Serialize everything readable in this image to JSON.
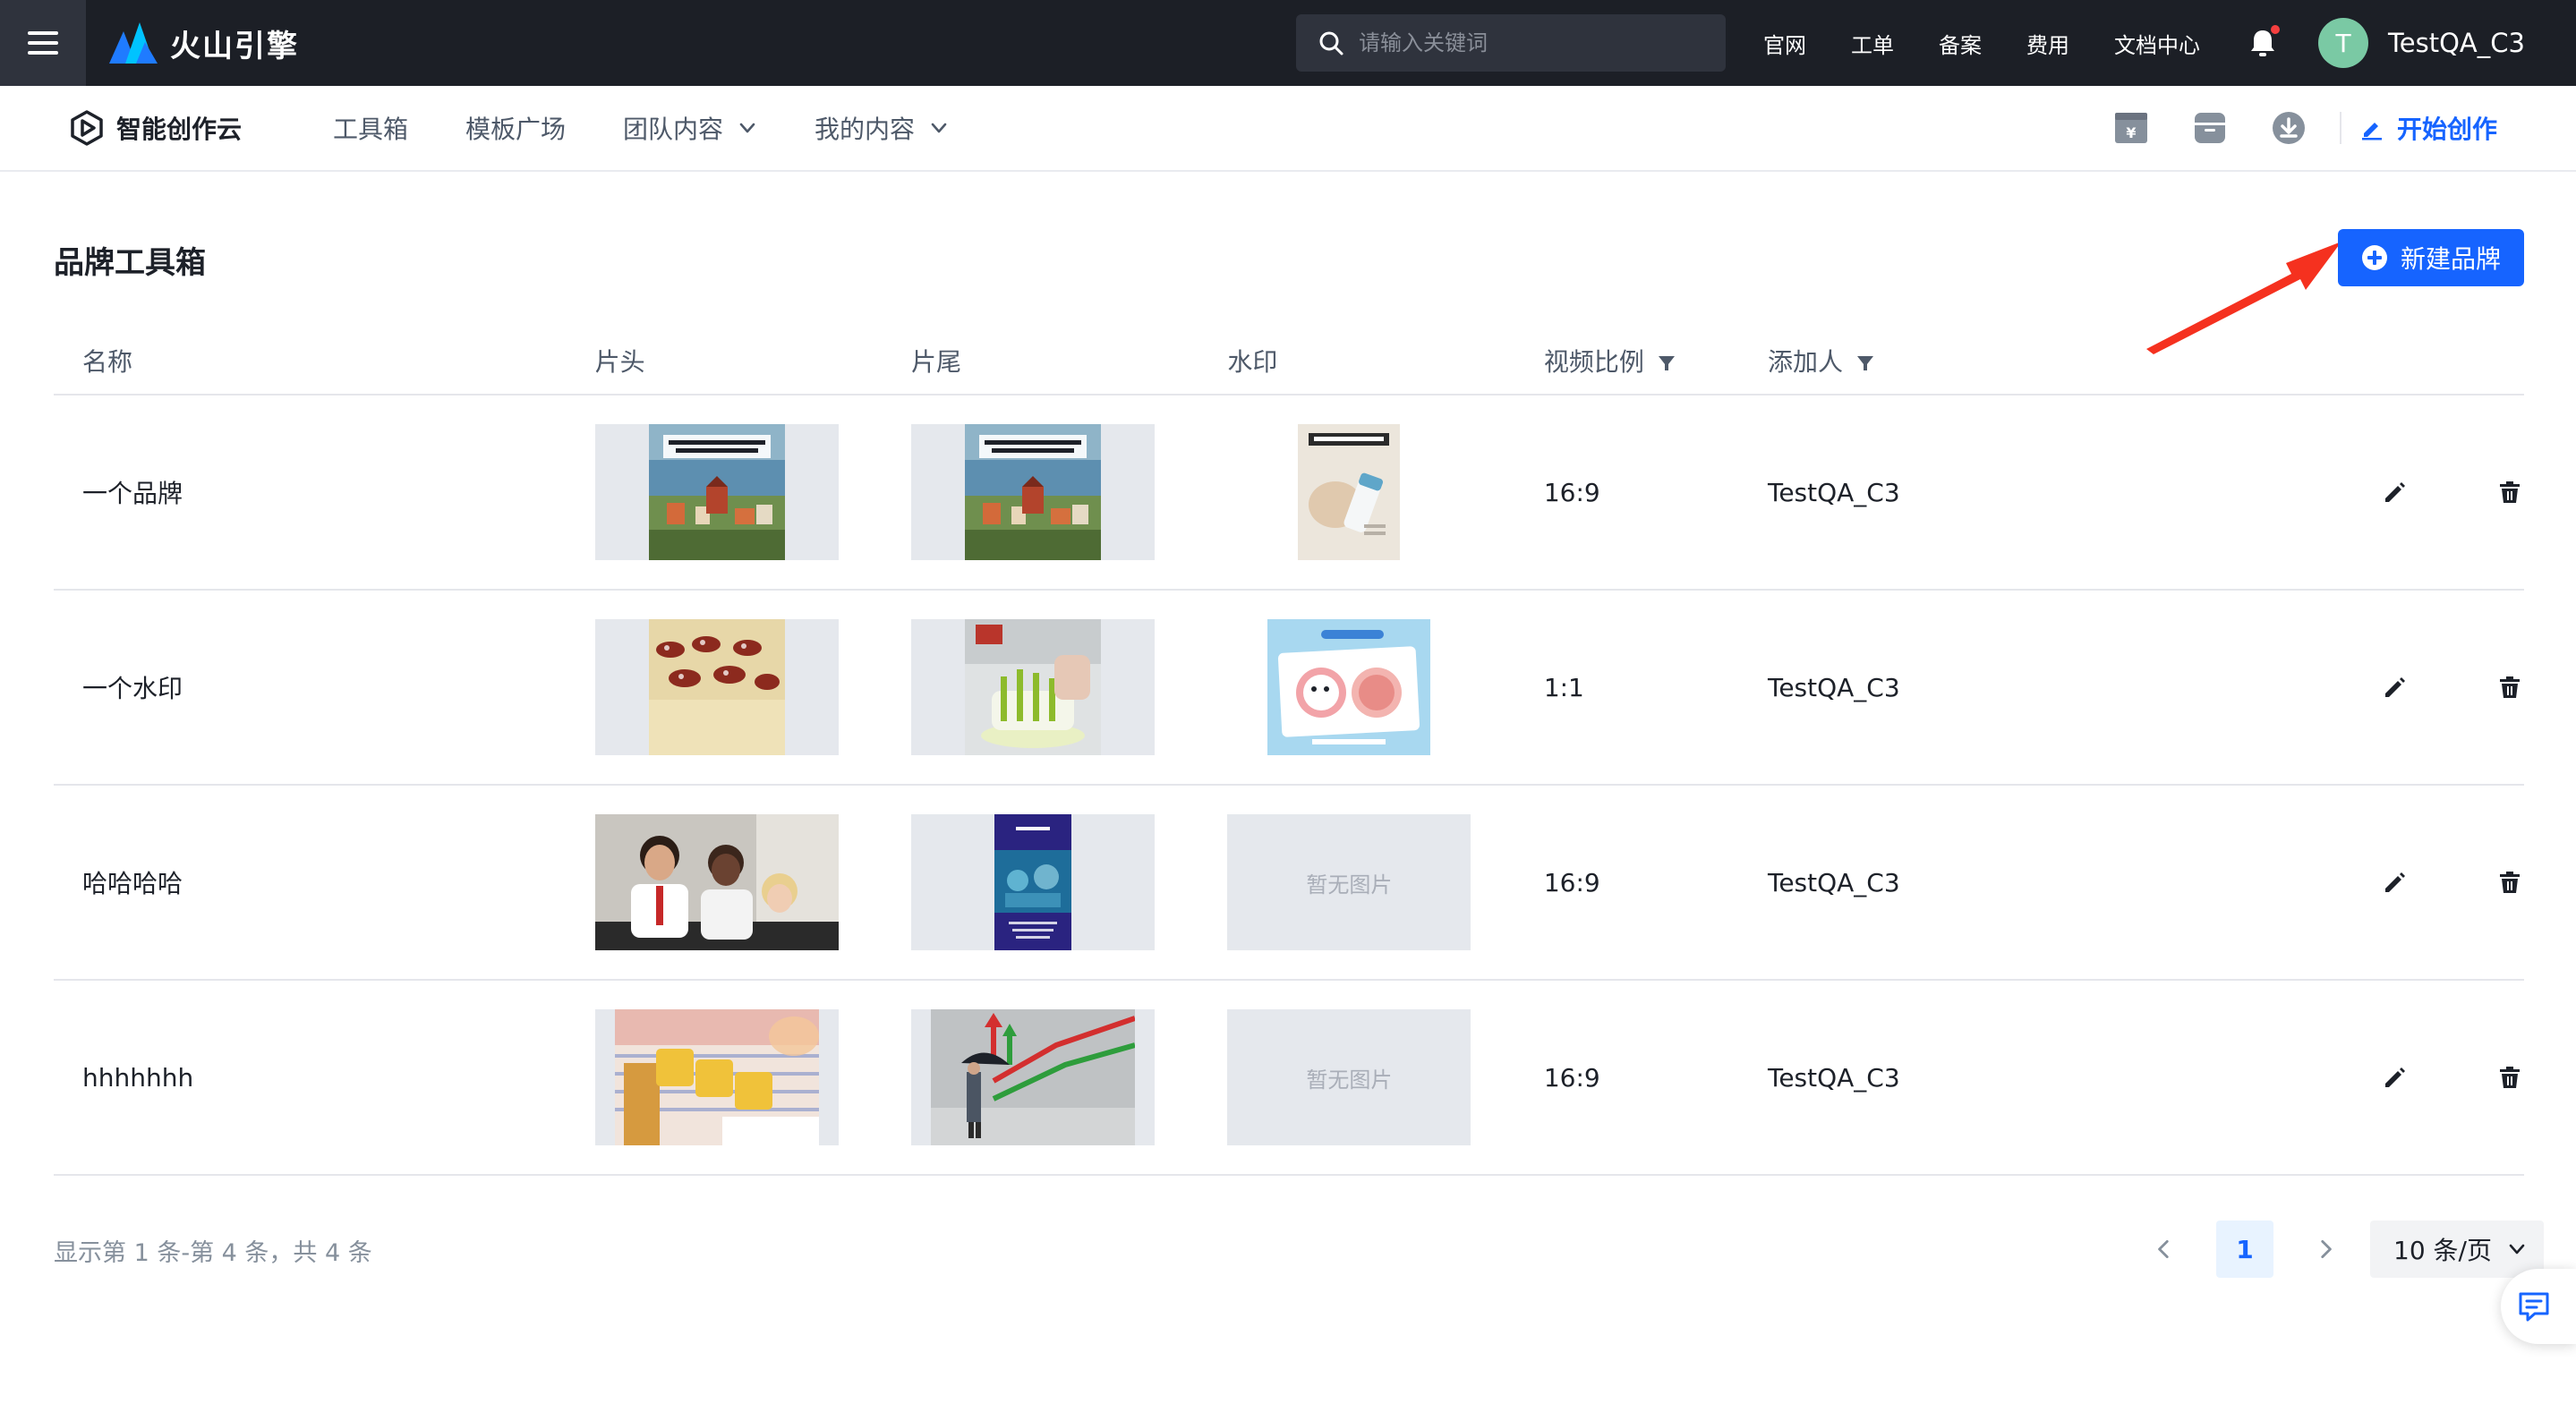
{
  "topbar": {
    "logo_text": "火山引擎",
    "search_placeholder": "请输入关键词",
    "links": [
      "官网",
      "工单",
      "备案",
      "费用",
      "文档中心"
    ],
    "avatar_initial": "T",
    "username": "TestQA_C3"
  },
  "subnav": {
    "brand": "智能创作云",
    "items": [
      {
        "label": "工具箱",
        "dropdown": false
      },
      {
        "label": "模板广场",
        "dropdown": false
      },
      {
        "label": "团队内容",
        "dropdown": true
      },
      {
        "label": "我的内容",
        "dropdown": true
      }
    ],
    "start_create": "开始创作"
  },
  "page": {
    "title": "品牌工具箱",
    "new_brand_button": "新建品牌"
  },
  "table": {
    "headers": {
      "name": "名称",
      "head": "片头",
      "tail": "片尾",
      "watermark": "水印",
      "ratio": "视频比例",
      "adder": "添加人"
    },
    "no_image_text": "暂无图片",
    "rows": [
      {
        "name": "一个品牌",
        "ratio": "16:9",
        "adder": "TestQA_C3"
      },
      {
        "name": "一个水印",
        "ratio": "1:1",
        "adder": "TestQA_C3"
      },
      {
        "name": "哈哈哈哈",
        "ratio": "16:9",
        "adder": "TestQA_C3"
      },
      {
        "name": "hhhhhhh",
        "ratio": "16:9",
        "adder": "TestQA_C3"
      }
    ]
  },
  "pagination": {
    "info": "显示第 1 条-第 4 条，共 4 条",
    "current_page": "1",
    "page_size": "10 条/页"
  },
  "colors": {
    "topbar_bg": "#1c1f26",
    "primary": "#1664ff",
    "annotation_arrow": "#f5311f",
    "avatar": "#7ac9a4"
  }
}
